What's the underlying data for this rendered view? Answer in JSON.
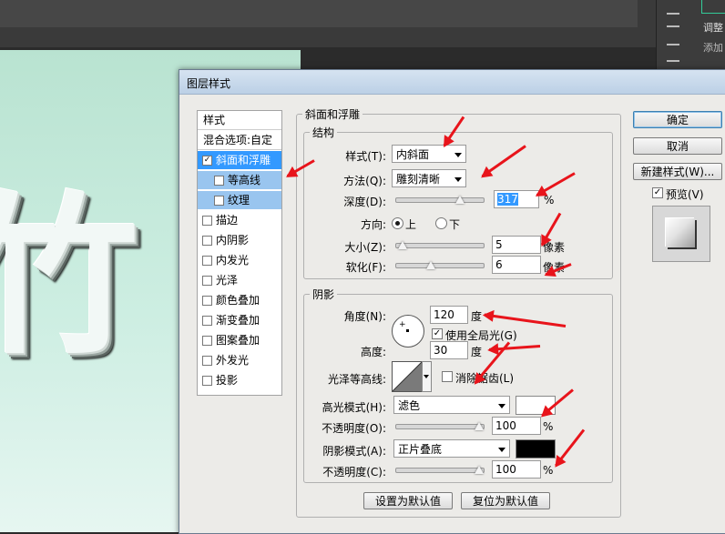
{
  "app": {
    "right_panel_adjust": "调整",
    "right_panel_add": "添加"
  },
  "canvas": {
    "sample_text": "竹"
  },
  "dialog": {
    "title": "图层样式",
    "style_list": {
      "header": "样式",
      "blend_options": "混合选项:自定",
      "items": [
        {
          "label": "斜面和浮雕",
          "checked": true,
          "selected": true,
          "sub": false
        },
        {
          "label": "等高线",
          "checked": false,
          "selected": false,
          "sub": true
        },
        {
          "label": "纹理",
          "checked": false,
          "selected": false,
          "sub": true
        },
        {
          "label": "描边",
          "checked": false,
          "selected": false,
          "sub": false
        },
        {
          "label": "内阴影",
          "checked": false,
          "selected": false,
          "sub": false
        },
        {
          "label": "内发光",
          "checked": false,
          "selected": false,
          "sub": false
        },
        {
          "label": "光泽",
          "checked": false,
          "selected": false,
          "sub": false
        },
        {
          "label": "颜色叠加",
          "checked": false,
          "selected": false,
          "sub": false
        },
        {
          "label": "渐变叠加",
          "checked": false,
          "selected": false,
          "sub": false
        },
        {
          "label": "图案叠加",
          "checked": false,
          "selected": false,
          "sub": false
        },
        {
          "label": "外发光",
          "checked": false,
          "selected": false,
          "sub": false
        },
        {
          "label": "投影",
          "checked": false,
          "selected": false,
          "sub": false
        }
      ]
    },
    "bevel": {
      "group_title": "斜面和浮雕",
      "structure_title": "结构",
      "style_label": "样式(T):",
      "style_value": "内斜面",
      "technique_label": "方法(Q):",
      "technique_value": "雕刻清晰",
      "depth_label": "深度(D):",
      "depth_value": "317",
      "depth_unit": "%",
      "depth_slider": 0.75,
      "direction_label": "方向:",
      "direction_up": "上",
      "direction_down": "下",
      "direction_selected": "上",
      "size_label": "大小(Z):",
      "size_value": "5",
      "size_unit": "像素",
      "size_slider": 0.02,
      "soften_label": "软化(F):",
      "soften_value": "6",
      "soften_unit": "像素",
      "soften_slider": 0.38
    },
    "shading": {
      "group_title": "阴影",
      "angle_label": "角度(N):",
      "angle_value": "120",
      "angle_unit": "度",
      "global_light_label": "使用全局光(G)",
      "global_light_checked": true,
      "altitude_label": "高度:",
      "altitude_value": "30",
      "altitude_unit": "度",
      "gloss_contour_label": "光泽等高线:",
      "antialias_label": "消除锯齿(L)",
      "antialias_checked": false,
      "highlight_mode_label": "高光模式(H):",
      "highlight_mode_value": "滤色",
      "highlight_color": "#ffffff",
      "highlight_opacity_label": "不透明度(O):",
      "highlight_opacity_value": "100",
      "highlight_opacity_unit": "%",
      "highlight_opacity_slider": 1.0,
      "shadow_mode_label": "阴影模式(A):",
      "shadow_mode_value": "正片叠底",
      "shadow_color": "#000000",
      "shadow_opacity_label": "不透明度(C):",
      "shadow_opacity_value": "100",
      "shadow_opacity_unit": "%",
      "shadow_opacity_slider": 1.0
    },
    "buttons": {
      "make_default": "设置为默认值",
      "reset_default": "复位为默认值",
      "ok": "确定",
      "cancel": "取消",
      "new_style": "新建样式(W)...",
      "preview": "预览(V)",
      "preview_checked": true
    }
  },
  "colors": {
    "annotation_arrow": "#e8141b",
    "selection": "#3399ff"
  }
}
